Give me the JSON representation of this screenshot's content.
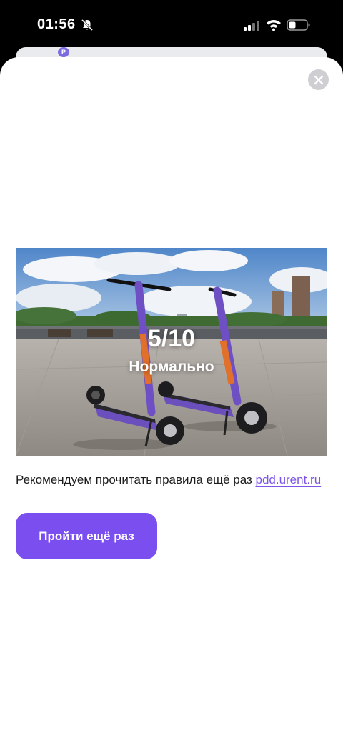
{
  "status_bar": {
    "time": "01:56",
    "icons": [
      "bell-slash-icon",
      "cellular-signal-icon",
      "wifi-icon",
      "battery-icon"
    ]
  },
  "map": {
    "pin_label": "P"
  },
  "result": {
    "score": "5/10",
    "rating": "Нормально"
  },
  "message": {
    "text": "Рекомендуем прочитать правила ещё раз ",
    "link_text": "pdd.urent.ru"
  },
  "actions": {
    "retry_label": "Пройти ещё раз",
    "close_icon": "close-icon"
  },
  "colors": {
    "accent": "#7b4ef0",
    "link": "#7d55e8",
    "close_bg": "#cfcfd3"
  }
}
